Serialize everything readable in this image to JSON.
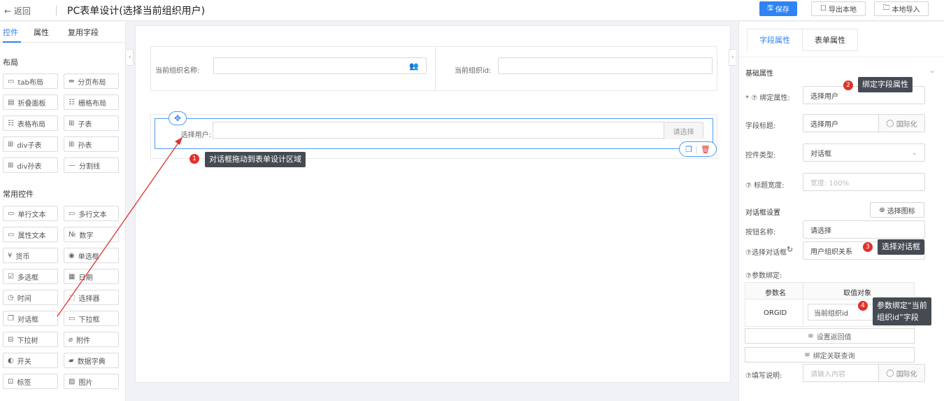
{
  "header": {
    "back_label": "← 返回",
    "title": "PC表单设计(选择当前组织用户)",
    "save_label": "保存",
    "export_label": "导出本地",
    "import_label": "本地导入"
  },
  "left_panel": {
    "tabs": [
      "控件",
      "属性",
      "复用字段"
    ],
    "layout_section": "布局",
    "layout_items": [
      "tab布局",
      "分页布局",
      "折叠面板",
      "栅格布局",
      "表格布局",
      "子表",
      "div子表",
      "孙表",
      "div孙表",
      "分割线"
    ],
    "common_section": "常用控件",
    "common_items": [
      "单行文本",
      "多行文本",
      "属性文本",
      "数字",
      "货币",
      "单选框",
      "多选框",
      "日期",
      "时间",
      "选择器",
      "对话框",
      "下拉框",
      "下拉树",
      "附件",
      "开关",
      "数据字典",
      "标签",
      "图片"
    ]
  },
  "canvas": {
    "org_name_label": "当前组织名称:",
    "org_id_label": "当前组织id:",
    "user_label": "选择用户:",
    "user_addon": "请选择"
  },
  "annotations": {
    "a1": {
      "num": "1",
      "text": "对话框拖动到表单设计区域"
    },
    "a2": {
      "num": "2",
      "text": "绑定字段属性"
    },
    "a3": {
      "num": "3",
      "text": "选择对话框"
    },
    "a4": {
      "num": "4",
      "text_line1": "参数绑定“当前",
      "text_line2": "组织id”字段"
    }
  },
  "right_panel": {
    "tabs": [
      "字段属性",
      "表单属性"
    ],
    "section_basic": "基础属性",
    "bind_label": "* ⑦ 绑定属性:",
    "bind_value": "选择用户",
    "title_label": "字段标题:",
    "title_value": "选择用户",
    "i18n_label": "国际化",
    "type_label": "控件类型:",
    "type_value": "对话框",
    "width_label": "⑦ 标题宽度:",
    "width_placeholder": "宽度: 100%",
    "dialog_settings": "对话框设置",
    "choose_icon": "选择图标",
    "btn_name_label": "按钮名称:",
    "btn_name_value": "请选择",
    "choose_dialog_label": "⑦选择对话框",
    "choose_dialog_value": "用户组织关系",
    "param_label": "⑦参数绑定:",
    "param_headers": [
      "参数名",
      "取值对象"
    ],
    "param_name": "ORGID",
    "param_value": "当前组织id",
    "set_return": "设置返回值",
    "bind_query": "绑定关联查询",
    "fill_desc_label": "⑦填写说明:",
    "fill_desc_placeholder": "请输入内容",
    "i18n_label2": "国际化"
  },
  "colors": {
    "accent": "#2f83f2",
    "badge": "#e1312b",
    "tip_bg": "#454b52",
    "arrow": "#e1312b"
  }
}
